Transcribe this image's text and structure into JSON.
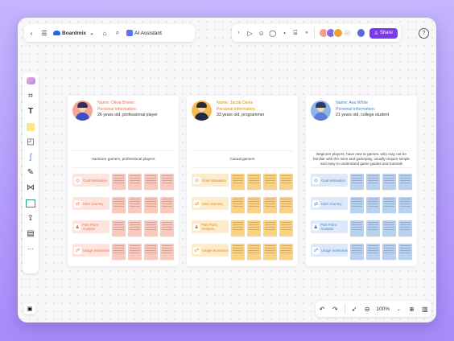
{
  "toolbar": {
    "brand": "Boardmix",
    "ai_label": "AI Assistant",
    "share_label": "Share",
    "help": "?"
  },
  "zoom": {
    "value": "100%"
  },
  "personas": [
    {
      "name": "Name: Olivia Brown",
      "info_label": "Personal information:",
      "info": "26 years old, professional player",
      "goal": "Hardcore gamers, professional players",
      "theme": "#f4a596",
      "note_color": "#f9c9bd",
      "label_bg": "#fde4dc",
      "text_color": "#e0735b",
      "rows": [
        "Goal Motivation",
        "User Journey",
        "Pain Point Analysis",
        "Usage Scenarios"
      ]
    },
    {
      "name": "Name: Jacob Davis",
      "info_label": "Personal information:",
      "info": "33 years old, programmer",
      "goal": "Casual gamers",
      "theme": "#f6b94f",
      "note_color": "#fbd283",
      "label_bg": "#fdebcc",
      "text_color": "#d98a12",
      "rows": [
        "Goal Motivation",
        "User Journey",
        "Pain Point Analysis",
        "Usage Scenarios"
      ]
    },
    {
      "name": "Name: Ava White",
      "info_label": "Personal information:",
      "info": "21 years old, college student",
      "goal": "Beginner players, have new to games, who may not be familiar with the rules and gameplay, usually require simple and easy to understand game guides and tutorials",
      "theme": "#8fb5e8",
      "note_color": "#b9d1f1",
      "label_bg": "#dde9f8",
      "text_color": "#4a7fc1",
      "rows": [
        "Goal Motivation",
        "User Journey",
        "Pain Point Analysis",
        "Usage Scenarios"
      ]
    }
  ]
}
